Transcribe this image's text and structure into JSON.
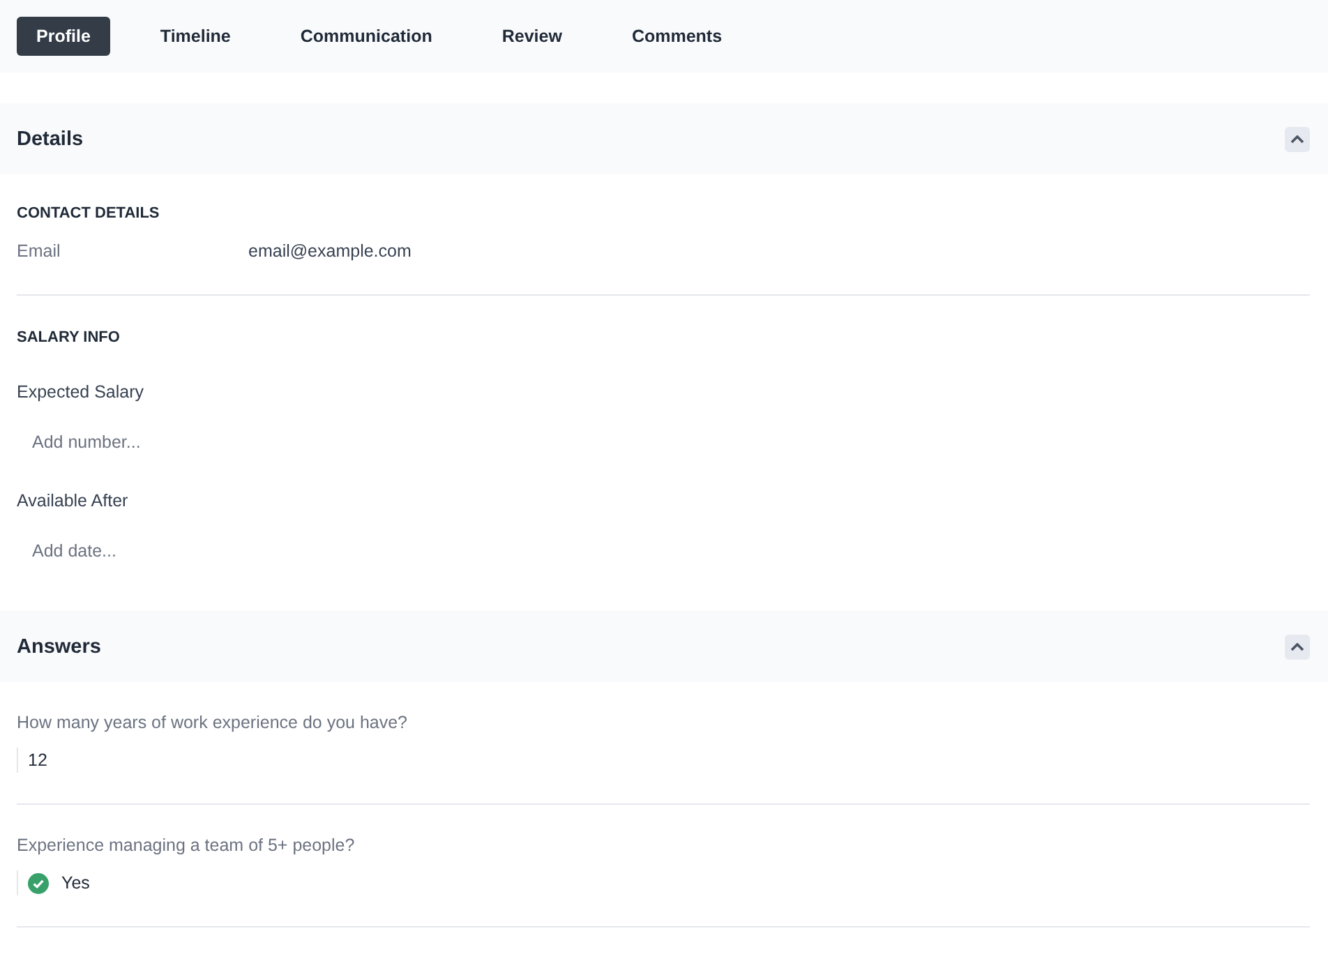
{
  "tabs": [
    {
      "label": "Profile",
      "selected": true
    },
    {
      "label": "Timeline",
      "selected": false
    },
    {
      "label": "Communication",
      "selected": false
    },
    {
      "label": "Review",
      "selected": false
    },
    {
      "label": "Comments",
      "selected": false
    }
  ],
  "details": {
    "title": "Details",
    "expanded": true,
    "contact": {
      "heading": "CONTACT DETAILS",
      "fields": [
        {
          "label": "Email",
          "value": "email@example.com"
        }
      ]
    },
    "salary": {
      "heading": "SALARY INFO",
      "fields": [
        {
          "label": "Expected Salary",
          "placeholder": "Add number..."
        },
        {
          "label": "Available After",
          "placeholder": "Add date..."
        }
      ]
    }
  },
  "answers": {
    "title": "Answers",
    "expanded": true,
    "items": [
      {
        "question": "How many years of work experience do you have?",
        "kind": "text",
        "answer": "12"
      },
      {
        "question": "Experience managing a team of 5+ people?",
        "kind": "boolean",
        "checked": true,
        "answer": "Yes"
      }
    ]
  }
}
